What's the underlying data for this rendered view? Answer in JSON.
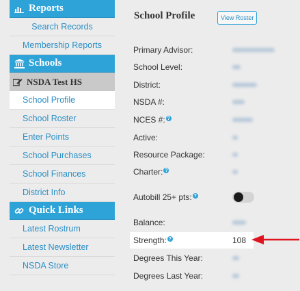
{
  "sidebar": {
    "reports": {
      "title": "Reports",
      "items": [
        "Search Records",
        "Membership Reports"
      ]
    },
    "schools": {
      "title": "Schools",
      "school_name": "NSDA Test HS",
      "items": [
        "School Profile",
        "School Roster",
        "Enter Points",
        "School Purchases",
        "School Finances",
        "District Info"
      ],
      "active_index": 0
    },
    "quick_links": {
      "title": "Quick Links",
      "items": [
        "Latest Rostrum",
        "Latest Newsletter",
        "NSDA Store"
      ]
    }
  },
  "profile": {
    "title": "School Profile",
    "view_roster_label": "View Roster",
    "fields": [
      {
        "label": "Primary Advisor:"
      },
      {
        "label": "School Level:"
      },
      {
        "label": "District:"
      },
      {
        "label": "NSDA #:"
      },
      {
        "label": "NCES #:"
      },
      {
        "label": "Active:"
      },
      {
        "label": "Resource Package:"
      },
      {
        "label": "Charter:"
      },
      {
        "label": "Autobill 25+ pts:"
      },
      {
        "label": "Balance:"
      },
      {
        "label": "Strength:",
        "value": "108"
      },
      {
        "label": "Degrees This Year:"
      },
      {
        "label": "Degrees Last Year:"
      }
    ],
    "help_glyph": "?"
  },
  "colors": {
    "accent": "#2ea3d8",
    "arrow": "#e0141e"
  }
}
